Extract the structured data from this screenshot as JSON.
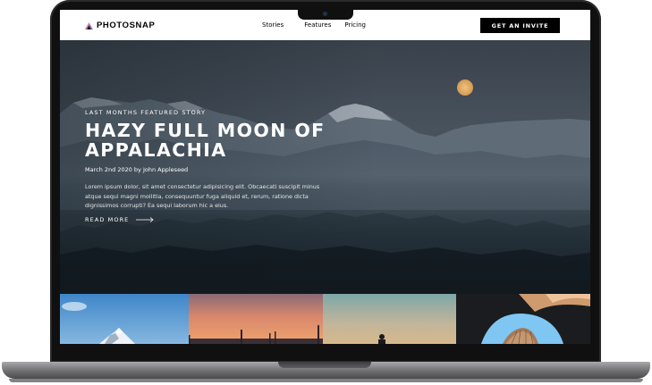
{
  "app": {
    "logo_text": "PHOTOSNAP"
  },
  "nav": {
    "items": [
      {
        "label": "Stories"
      },
      {
        "label": "Features"
      },
      {
        "label": "Pricing"
      }
    ],
    "cta_label": "GET AN INVITE"
  },
  "hero": {
    "eyebrow": "LAST MONTHS FEATURED STORY",
    "title_line1": "HAZY FULL MOON OF",
    "title_line2": "APPALACHIA",
    "byline": "March 2nd 2020 by John Appleseed",
    "excerpt": "Lorem ipsum dolor, sit amet consectetur adipisicing elit. Obcaecati suscipit minus atque sequi magni mollitia, consequuntur fuga aliquid et, rerum, ratione dicta dignissimos corrupti? Ea sequi laborum hic a eius.",
    "read_more_label": "READ MORE"
  },
  "gallery": {
    "tiles": [
      {
        "name": "mountain-summit"
      },
      {
        "name": "sunset-pier"
      },
      {
        "name": "desert-silhouette"
      },
      {
        "name": "architecture-arch"
      }
    ]
  },
  "colors": {
    "accent_gradient": [
      "#ffc593",
      "#bc7198",
      "#5a77ff"
    ],
    "nav_background": "#ffffff",
    "button_background": "#000000"
  }
}
